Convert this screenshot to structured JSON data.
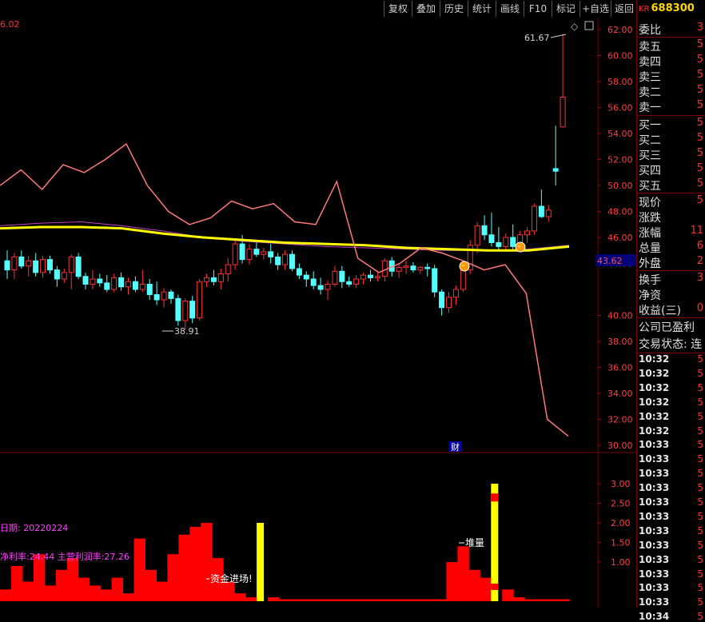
{
  "toolbar": {
    "buttons": [
      "复权",
      "叠加",
      "历史",
      "统计",
      "画线",
      "F10",
      "标记",
      "+自选",
      "返回"
    ]
  },
  "previous_label": "6.02",
  "stock": {
    "prefix": "KR",
    "code": "688300"
  },
  "main_panel": {
    "max_label": "61.67",
    "min_label": "38.91",
    "price_tag": "43.62",
    "finance_marker": "财",
    "y_ticks": [
      "62.00",
      "60.00",
      "58.00",
      "56.00",
      "54.00",
      "52.00",
      "50.00",
      "48.00",
      "46.00",
      "44.00",
      "40.00",
      "38.00",
      "36.00",
      "34.00",
      "32.00",
      "30.00"
    ]
  },
  "sub_panel": {
    "y_ticks": [
      "3.00",
      "2.50",
      "2.00",
      "1.50",
      "1.00"
    ],
    "date_text": "日期: 20220224",
    "ratio_text": "净利率:24.44 主营利润率:27.26",
    "label_capital": "资金进场!",
    "label_pile": "堆量"
  },
  "quote_panel": {
    "rows": [
      {
        "label": "委比",
        "value": "3"
      },
      {
        "label": "卖五",
        "value": "5"
      },
      {
        "label": "卖四",
        "value": "5"
      },
      {
        "label": "卖三",
        "value": "5"
      },
      {
        "label": "卖二",
        "value": "5"
      },
      {
        "label": "卖一",
        "value": "5"
      },
      {
        "label": "买一",
        "value": "5"
      },
      {
        "label": "买二",
        "value": "5"
      },
      {
        "label": "买三",
        "value": "5"
      },
      {
        "label": "买四",
        "value": "5"
      },
      {
        "label": "买五",
        "value": "5"
      },
      {
        "label": "现价",
        "value": "5"
      },
      {
        "label": "涨跌",
        "value": ""
      },
      {
        "label": "涨幅",
        "value": "11"
      },
      {
        "label": "总量",
        "value": "6"
      },
      {
        "label": "外盘",
        "value": "2"
      },
      {
        "label": "换手",
        "value": "3"
      },
      {
        "label": "净资",
        "value": ""
      },
      {
        "label": "收益(三)",
        "value": "0"
      },
      {
        "label": "公司已盈利",
        "value": ""
      },
      {
        "label": "交易状态: 连",
        "value": ""
      }
    ],
    "ticks": [
      {
        "time": "10:32",
        "value": "5"
      },
      {
        "time": "10:32",
        "value": "5"
      },
      {
        "time": "10:32",
        "value": "5"
      },
      {
        "time": "10:32",
        "value": "5"
      },
      {
        "time": "10:32",
        "value": "5"
      },
      {
        "time": "10:32",
        "value": "5"
      },
      {
        "time": "10:33",
        "value": "5"
      },
      {
        "time": "10:33",
        "value": "5"
      },
      {
        "time": "10:33",
        "value": "5"
      },
      {
        "time": "10:33",
        "value": "5"
      },
      {
        "time": "10:33",
        "value": "5"
      },
      {
        "time": "10:33",
        "value": "5"
      },
      {
        "time": "10:33",
        "value": "5"
      },
      {
        "time": "10:33",
        "value": "5"
      },
      {
        "time": "10:33",
        "value": "5"
      },
      {
        "time": "10:33",
        "value": "5"
      },
      {
        "time": "10:33",
        "value": "5"
      },
      {
        "time": "10:33",
        "value": "5"
      },
      {
        "time": "10:34",
        "value": "5"
      }
    ]
  },
  "chart_data": {
    "type": "candlestick",
    "candles": [
      [
        44.2,
        45.0,
        42.8,
        43.5
      ],
      [
        43.5,
        44.8,
        42.8,
        44.5
      ],
      [
        44.5,
        45.0,
        43.6,
        43.8
      ],
      [
        43.8,
        44.6,
        43.0,
        44.2
      ],
      [
        44.2,
        44.8,
        43.0,
        43.3
      ],
      [
        43.3,
        44.6,
        42.9,
        44.3
      ],
      [
        44.3,
        44.6,
        43.2,
        43.5
      ],
      [
        43.5,
        43.8,
        42.2,
        42.8
      ],
      [
        42.8,
        43.6,
        42.5,
        43.3
      ],
      [
        43.3,
        44.7,
        42.0,
        44.5
      ],
      [
        44.5,
        44.8,
        42.8,
        43.0
      ],
      [
        43.0,
        43.3,
        42.0,
        42.4
      ],
      [
        42.4,
        43.5,
        42.0,
        42.8
      ],
      [
        42.8,
        43.2,
        42.2,
        42.5
      ],
      [
        42.5,
        43.1,
        41.8,
        42.0
      ],
      [
        42.0,
        43.2,
        41.8,
        42.9
      ],
      [
        42.9,
        43.3,
        41.9,
        42.2
      ],
      [
        42.2,
        42.9,
        41.6,
        42.6
      ],
      [
        42.6,
        43.0,
        41.8,
        42.0
      ],
      [
        42.0,
        43.5,
        41.8,
        42.4
      ],
      [
        42.4,
        42.8,
        41.2,
        41.6
      ],
      [
        41.6,
        42.6,
        40.8,
        41.2
      ],
      [
        41.2,
        42.1,
        40.6,
        41.8
      ],
      [
        41.8,
        42.0,
        40.9,
        41.3
      ],
      [
        41.3,
        41.6,
        39.2,
        39.6
      ],
      [
        39.6,
        41.3,
        38.9,
        41.1
      ],
      [
        41.1,
        41.5,
        39.4,
        39.8
      ],
      [
        39.8,
        42.8,
        39.6,
        42.6
      ],
      [
        42.6,
        43.2,
        42.2,
        42.9
      ],
      [
        42.9,
        43.5,
        42.3,
        42.6
      ],
      [
        42.6,
        43.6,
        42.0,
        43.2
      ],
      [
        43.2,
        44.4,
        42.6,
        43.9
      ],
      [
        43.9,
        45.8,
        43.5,
        45.5
      ],
      [
        45.5,
        46.2,
        44.0,
        44.3
      ],
      [
        44.3,
        45.5,
        43.9,
        45.1
      ],
      [
        45.1,
        45.6,
        44.5,
        44.7
      ],
      [
        44.7,
        45.2,
        44.3,
        44.9
      ],
      [
        44.9,
        45.5,
        44.0,
        44.5
      ],
      [
        44.5,
        44.8,
        43.5,
        43.9
      ],
      [
        43.9,
        45.0,
        43.5,
        44.7
      ],
      [
        44.7,
        45.0,
        43.4,
        43.6
      ],
      [
        43.6,
        44.0,
        42.8,
        43.1
      ],
      [
        43.1,
        43.4,
        42.2,
        42.8
      ],
      [
        42.8,
        43.4,
        42.0,
        42.3
      ],
      [
        42.3,
        42.9,
        41.6,
        42.0
      ],
      [
        42.0,
        42.7,
        41.2,
        42.4
      ],
      [
        42.4,
        43.8,
        42.2,
        43.4
      ],
      [
        43.4,
        43.8,
        42.1,
        42.6
      ],
      [
        42.6,
        43.0,
        42.2,
        42.4
      ],
      [
        42.4,
        43.1,
        42.1,
        42.8
      ],
      [
        42.8,
        43.3,
        42.4,
        43.1
      ],
      [
        43.1,
        43.5,
        42.6,
        42.9
      ],
      [
        42.9,
        43.3,
        42.6,
        43.0
      ],
      [
        43.0,
        44.4,
        42.6,
        44.2
      ],
      [
        44.2,
        44.5,
        43.0,
        43.4
      ],
      [
        43.4,
        44.0,
        42.9,
        43.7
      ],
      [
        43.7,
        44.2,
        43.2,
        43.8
      ],
      [
        43.8,
        44.1,
        43.3,
        43.5
      ],
      [
        43.5,
        43.8,
        43.2,
        43.7
      ],
      [
        43.7,
        44.0,
        43.0,
        43.6
      ],
      [
        43.6,
        43.9,
        41.4,
        41.8
      ],
      [
        41.8,
        42.0,
        40.0,
        40.6
      ],
      [
        40.6,
        41.8,
        40.2,
        41.4
      ],
      [
        41.4,
        42.3,
        40.8,
        42.0
      ],
      [
        42.0,
        44.0,
        41.8,
        43.5
      ],
      [
        43.5,
        45.8,
        43.2,
        45.4
      ],
      [
        45.4,
        47.2,
        44.8,
        46.9
      ],
      [
        46.9,
        47.7,
        45.8,
        46.2
      ],
      [
        46.2,
        47.9,
        45.3,
        45.6
      ],
      [
        45.6,
        46.8,
        45.0,
        45.3
      ],
      [
        45.3,
        46.3,
        44.9,
        46.0
      ],
      [
        46.0,
        47.0,
        45.0,
        45.3
      ],
      [
        45.3,
        46.5,
        44.9,
        46.2
      ],
      [
        46.2,
        46.8,
        45.6,
        46.5
      ],
      [
        46.5,
        48.6,
        46.2,
        48.4
      ],
      [
        48.4,
        49.7,
        47.5,
        47.6
      ],
      [
        47.6,
        48.5,
        47.2,
        48.1
      ],
      [
        51.3,
        54.6,
        50.0,
        51.1
      ],
      [
        54.5,
        61.67,
        54.5,
        56.8
      ]
    ],
    "ma_yellow": [
      46.7,
      46.8,
      46.8,
      46.7,
      46.3,
      46.0,
      45.8,
      45.6,
      45.5,
      45.4,
      45.2,
      45.1,
      45.0,
      45.0,
      45.3
    ],
    "ma_magenta": [
      46.9,
      47.1,
      47.2,
      46.9,
      46.5,
      46.0,
      45.7,
      45.5,
      45.3,
      45.2,
      45.1,
      45.0,
      45.0,
      45.1,
      45.4
    ],
    "pink_line": [
      50.0,
      51.2,
      49.7,
      51.6,
      51.0,
      52.0,
      53.2,
      50.0,
      48.0,
      47.0,
      47.5,
      48.8,
      48.2,
      48.6,
      47.2,
      47.0,
      50.3,
      44.4,
      43.3,
      44.0,
      45.2,
      44.8,
      44.2,
      43.5,
      43.9,
      41.7,
      32.0,
      30.7
    ],
    "volume": [
      0.3,
      0.9,
      0.5,
      1.2,
      0.4,
      0.8,
      1.1,
      0.6,
      0.4,
      0.3,
      0.6,
      0.2,
      1.6,
      0.8,
      0.5,
      1.2,
      1.7,
      1.9,
      2.0,
      1.1,
      0.5,
      0.2,
      0.1,
      2.0,
      0.1,
      0.05,
      0.05,
      0.05,
      0.05,
      0.05,
      0.05,
      0.05,
      0.05,
      0.05,
      0.05,
      0.05,
      0.05,
      0.05,
      0.05,
      0.05,
      1.0,
      1.4,
      0.8,
      0.6,
      3.0,
      0.3,
      0.1,
      0.05,
      0.05,
      0.05,
      0.05
    ]
  }
}
